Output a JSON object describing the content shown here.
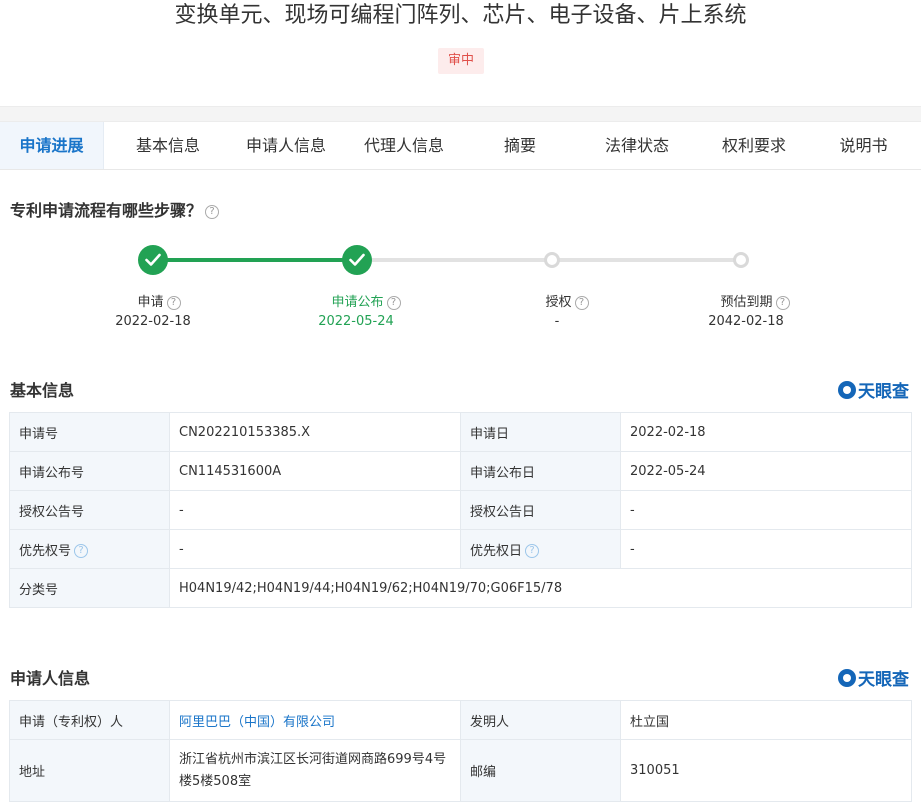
{
  "header": {
    "title": "变换单元、现场可编程门阵列、芯片、电子设备、片上系统",
    "status_badge": "审中"
  },
  "tabs": [
    {
      "label": "申请进展",
      "active": true
    },
    {
      "label": "基本信息"
    },
    {
      "label": "申请人信息"
    },
    {
      "label": "代理人信息"
    },
    {
      "label": "摘要"
    },
    {
      "label": "法律状态"
    },
    {
      "label": "权利要求"
    },
    {
      "label": "说明书"
    }
  ],
  "progress": {
    "heading": "专利申请流程有哪些步骤？",
    "steps": [
      {
        "label": "申请",
        "date": "2022-02-18",
        "state": "done"
      },
      {
        "label": "申请公布",
        "date": "2022-05-24",
        "state": "done"
      },
      {
        "label": "授权",
        "date": "-",
        "state": "todo"
      },
      {
        "label": "预估到期",
        "date": "2042-02-18",
        "state": "todo"
      }
    ]
  },
  "brand": {
    "name": "天眼查"
  },
  "basic_info": {
    "heading": "基本信息",
    "rows": [
      {
        "l1": "申请号",
        "v1": "CN202210153385.X",
        "l2": "申请日",
        "v2": "2022-02-18"
      },
      {
        "l1": "申请公布号",
        "v1": "CN114531600A",
        "l2": "申请公布日",
        "v2": "2022-05-24"
      },
      {
        "l1": "授权公告号",
        "v1": "-",
        "l2": "授权公告日",
        "v2": "-"
      },
      {
        "l1": "优先权号",
        "v1": "-",
        "l2": "优先权日",
        "v2": "-"
      }
    ],
    "classification_label": "分类号",
    "classification_value": "H04N19/42;H04N19/44;H04N19/62;H04N19/70;G06F15/78"
  },
  "applicant_info": {
    "heading": "申请人信息",
    "applicant_label": "申请（专利权）人",
    "applicant_value": "阿里巴巴（中国）有限公司",
    "inventor_label": "发明人",
    "inventor_value": "杜立国",
    "address_label": "地址",
    "address_value": "浙江省杭州市滨江区长河街道网商路699号4号楼5楼508室",
    "postcode_label": "邮编",
    "postcode_value": "310051"
  },
  "colors": {
    "accent": "#1a75c9",
    "done": "#22a254",
    "badge": "#e0504a",
    "brand": "#1466b8"
  },
  "icons": {
    "help": "question-circle-icon",
    "check": "check-icon"
  }
}
